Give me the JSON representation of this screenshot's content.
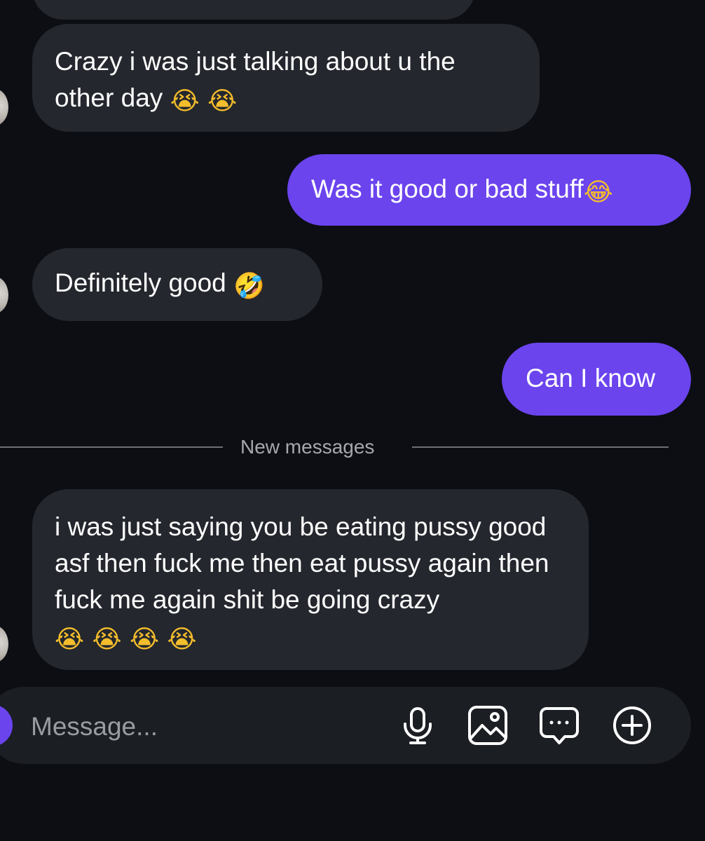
{
  "messages": [
    {
      "direction": "incoming",
      "text": "Crazy i was just talking about u the other day",
      "emoji": "😭 😭",
      "emoji_names": [
        "loudly-crying-face",
        "loudly-crying-face"
      ]
    },
    {
      "direction": "outgoing",
      "text": "Was it good or bad stuff",
      "emoji": "😂",
      "emoji_names": [
        "face-with-tears-of-joy"
      ]
    },
    {
      "direction": "incoming",
      "text": "Definitely good",
      "emoji": "🤣",
      "emoji_names": [
        "rolling-on-the-floor-laughing"
      ]
    },
    {
      "direction": "outgoing",
      "text": "Can I know",
      "emoji": "",
      "emoji_names": []
    },
    {
      "direction": "incoming",
      "text": "i was just saying you be eating pussy good asf then fuck me then eat pussy again then fuck me again shit be going crazy",
      "emoji": "😭 😭 😭 😭",
      "emoji_names": [
        "loudly-crying-face",
        "loudly-crying-face",
        "loudly-crying-face",
        "loudly-crying-face"
      ]
    }
  ],
  "divider": {
    "label": "New messages"
  },
  "composer": {
    "placeholder": "Message...",
    "icons": [
      "microphone-icon",
      "image-icon",
      "message-more-icon",
      "plus-circle-icon"
    ]
  },
  "colors": {
    "background": "#0c0e13",
    "incoming_bubble": "#24272d",
    "outgoing_bubble": "#6b44ee",
    "composer_background": "#1b1e23",
    "divider_text": "#a6a8ad"
  }
}
